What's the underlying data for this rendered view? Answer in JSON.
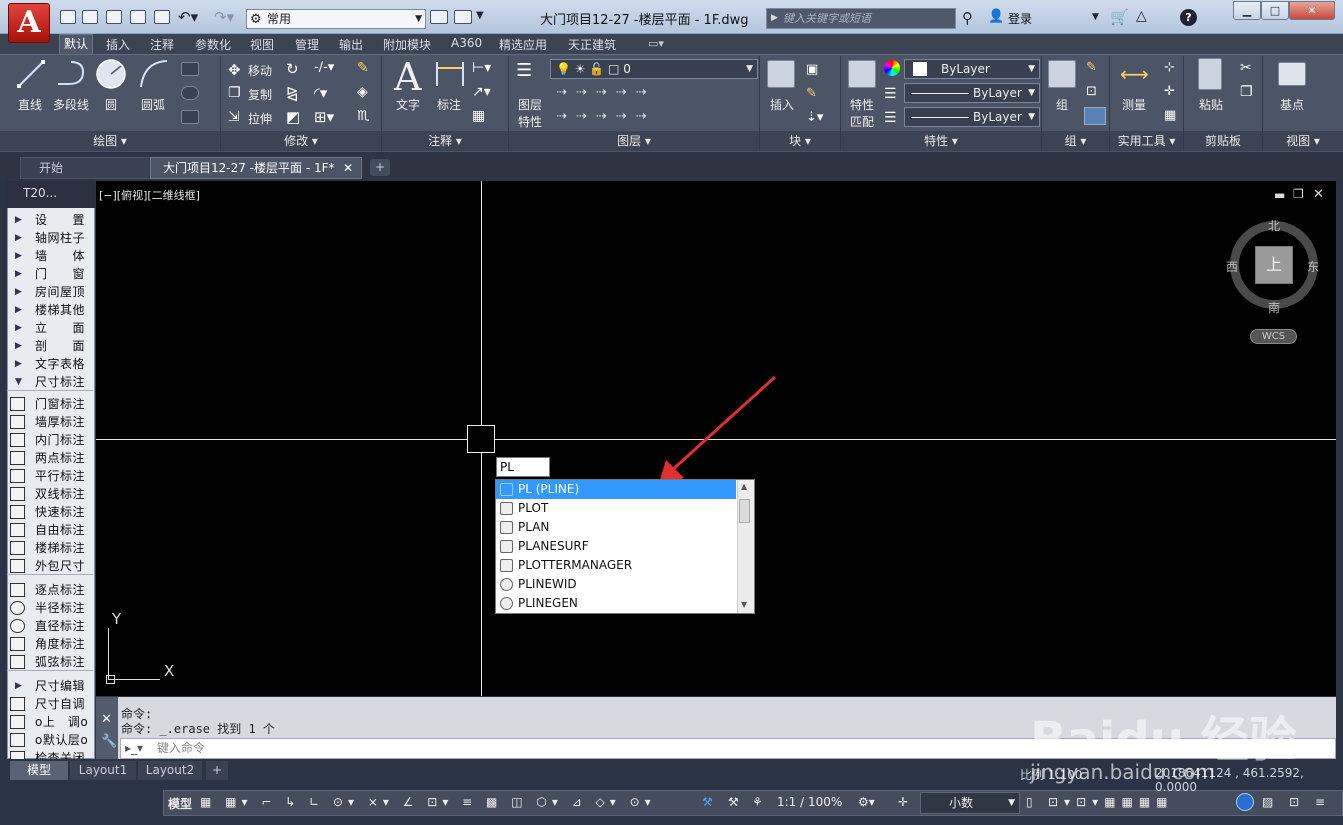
{
  "app": {
    "logo_letter": "A",
    "title": "大门项目12-27 -楼层平面 - 1F.dwg"
  },
  "quick_access": {
    "workspace": "常用",
    "search_placeholder": "键入关键字或短语",
    "login": "登录"
  },
  "ribbon_tabs": [
    "默认",
    "插入",
    "注释",
    "参数化",
    "视图",
    "管理",
    "输出",
    "附加模块",
    "A360",
    "精选应用",
    "天正建筑"
  ],
  "ribbon": {
    "draw": {
      "line": "直线",
      "polyline": "多段线",
      "circle": "圆",
      "arc": "圆弧",
      "panel": "绘图 ▾"
    },
    "modify": {
      "move": "移动",
      "copy": "复制",
      "stretch": "拉伸",
      "panel": "修改 ▾"
    },
    "annotation": {
      "text": "文字",
      "dim": "标注",
      "panel": "注释 ▾"
    },
    "layers": {
      "props1": "图层",
      "props2": "特性",
      "current_layer": "0",
      "panel": "图层 ▾"
    },
    "block": {
      "insert": "插入",
      "panel": "块 ▾"
    },
    "properties": {
      "match1": "特性",
      "match2": "匹配",
      "color": "ByLayer",
      "linetype": "ByLayer",
      "lineweight": "ByLayer",
      "panel": "特性 ▾"
    },
    "groups": {
      "group": "组",
      "panel": "组 ▾"
    },
    "utilities": {
      "measure": "测量",
      "panel": "实用工具 ▾"
    },
    "clipboard": {
      "paste": "粘贴",
      "panel": "剪贴板"
    },
    "view": {
      "base": "基点",
      "panel": "视图 ▾"
    }
  },
  "doc_tabs": {
    "start": "开始",
    "current": "大门项目12-27 -楼层平面 - 1F*",
    "plus": "+"
  },
  "palette": {
    "title": "T20...",
    "menu": [
      "设　　置",
      "轴网柱子",
      "墙　　体",
      "门　　窗",
      "房间屋顶",
      "楼梯其他",
      "立　　面",
      "剖　　面",
      "文字表格",
      "尺寸标注"
    ],
    "dims1": [
      "门窗标注",
      "墙厚标注",
      "内门标注",
      "两点标注",
      "平行标注",
      "双线标注",
      "快速标注",
      "自由标注",
      "楼梯标注",
      "外包尺寸"
    ],
    "dims2": [
      "逐点标注",
      "半径标注",
      "直径标注",
      "角度标注",
      "弧弦标注"
    ],
    "dims3": [
      "尺寸编辑",
      "尺寸自调",
      "o上　调o",
      "o默认层o",
      "检查关闭"
    ]
  },
  "viewport": {
    "label": "[−][俯视][二维线框]",
    "compass": {
      "north": "北",
      "south": "南",
      "east": "东",
      "west": "西",
      "top": "上"
    },
    "wcs": "WCS",
    "ucs_x": "X",
    "ucs_y": "Y"
  },
  "autocomplete": {
    "typed": "PL",
    "items": [
      "PL (PLINE)",
      "PLOT",
      "PLAN",
      "PLANESURF",
      "PLOTTERMANAGER",
      "PLINEWID",
      "PLINEGEN"
    ]
  },
  "command": {
    "line1": "命令:",
    "line2": "命令: _.erase 找到 1 个",
    "placeholder": "键入命令"
  },
  "layout_tabs": [
    "模型",
    "Layout1",
    "Layout2",
    "+"
  ],
  "status": {
    "model": "模型",
    "scale": "1:1 / 100%",
    "units": "小数",
    "annoscale": "比例 1:100",
    "coords": "2018641124 , 461.2592, 0.0000"
  },
  "watermark": {
    "text": "Baidu 经验",
    "url": "jingyan.baidu.com"
  }
}
